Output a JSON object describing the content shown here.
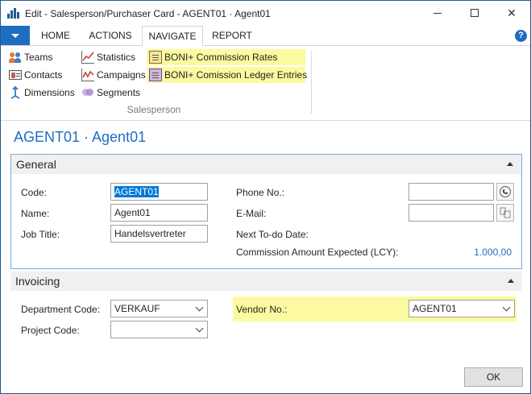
{
  "window": {
    "title": "Edit - Salesperson/Purchaser Card - AGENT01 · Agent01"
  },
  "ribbon": {
    "tabs": [
      "HOME",
      "ACTIONS",
      "NAVIGATE",
      "REPORT"
    ],
    "active_tab": "NAVIGATE",
    "group_label": "Salesperson",
    "items": {
      "teams": "Teams",
      "contacts": "Contacts",
      "dimensions": "Dimensions",
      "statistics": "Statistics",
      "campaigns": "Campaigns",
      "segments": "Segments",
      "boni_rates": "BONI+ Commission Rates",
      "boni_ledger": "BONI+ Comission Ledger Entries"
    },
    "highlight_color": "#fbfaa0",
    "accent_color": "#1e6ec0"
  },
  "page": {
    "title": "AGENT01 · Agent01"
  },
  "general": {
    "title": "General",
    "code_label": "Code:",
    "code_value": "AGENT01",
    "name_label": "Name:",
    "name_value": "Agent01",
    "job_title_label": "Job Title:",
    "job_title_value": "Handelsvertreter",
    "phone_label": "Phone No.:",
    "phone_value": "",
    "email_label": "E-Mail:",
    "email_value": "",
    "next_todo_label": "Next To-do Date:",
    "commission_label": "Commission Amount Expected (LCY):",
    "commission_value": "1.000,00"
  },
  "invoicing": {
    "title": "Invoicing",
    "department_label": "Department Code:",
    "department_value": "VERKAUF",
    "project_label": "Project Code:",
    "project_value": "",
    "vendor_label": "Vendor No.:",
    "vendor_value": "AGENT01"
  },
  "buttons": {
    "ok": "OK"
  },
  "icons": [
    "app-icon",
    "minimize-icon",
    "maximize-icon",
    "close-icon",
    "file-menu-icon",
    "help-icon",
    "teams-icon",
    "contacts-icon",
    "dimensions-icon",
    "statistics-icon",
    "campaigns-icon",
    "segments-icon",
    "commission-rates-icon",
    "ledger-entries-icon",
    "collapse-icon",
    "phone-dial-icon",
    "email-compose-icon",
    "chevron-down-icon"
  ]
}
